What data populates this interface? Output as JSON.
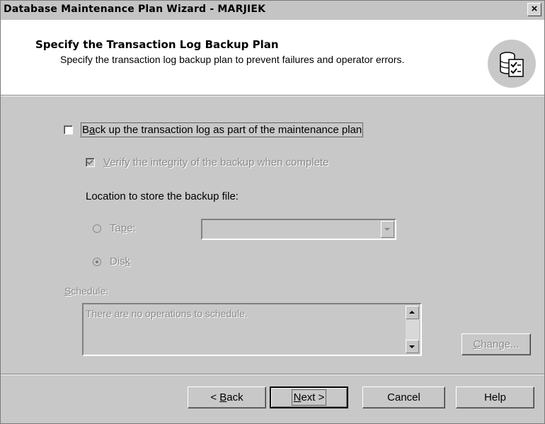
{
  "window": {
    "title": "Database Maintenance Plan Wizard - MARJIEK",
    "close_label": "×"
  },
  "header": {
    "title": "Specify the Transaction Log Backup Plan",
    "subtitle": "Specify the transaction log backup plan to prevent failures and operator errors.",
    "icon": "database-checklist-icon"
  },
  "options": {
    "backup_log": {
      "label_pre": "B",
      "label_accel": "a",
      "label_post": "ck up the transaction log as part of the maintenance plan",
      "checked": false
    },
    "verify": {
      "label_accel": "V",
      "label_post": "erify the integrity of the backup when complete",
      "checked": true,
      "enabled": false
    },
    "location_label": "Location to store the backup file:",
    "tape": {
      "label_pre": "Ta",
      "label_accel": "p",
      "label_post": "e:",
      "selected": false
    },
    "tape_combo_value": "",
    "disk": {
      "label_pre": "Dis",
      "label_accel": "k",
      "label_post": "",
      "selected": true
    }
  },
  "schedule": {
    "label_accel": "S",
    "label_post": "chedule:",
    "text": "There are no operations to schedule.",
    "change_accel": "C",
    "change_post": "hange..."
  },
  "buttons": {
    "back_pre": "< ",
    "back_accel": "B",
    "back_post": "ack",
    "next_accel": "N",
    "next_post": "ext >",
    "cancel": "Cancel",
    "help": "Help"
  }
}
